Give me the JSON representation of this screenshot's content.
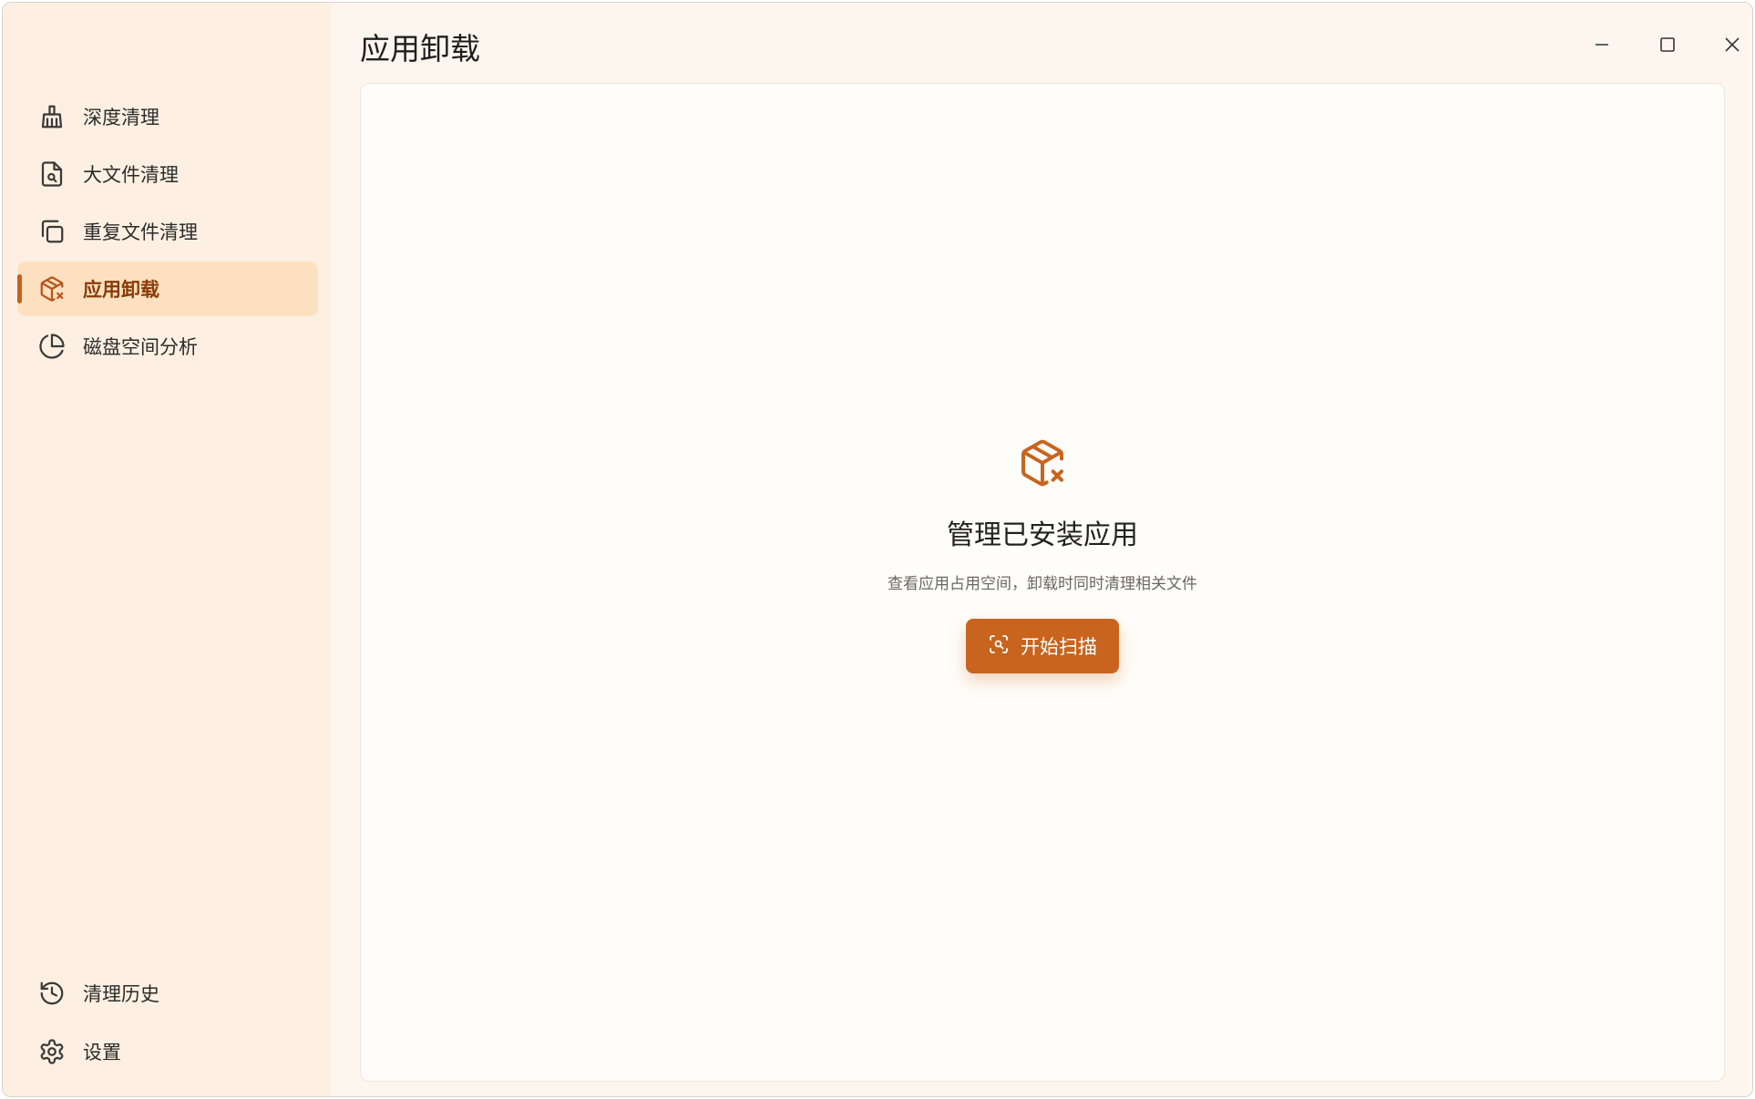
{
  "window": {
    "title": "应用卸载"
  },
  "sidebar": {
    "items": [
      {
        "label": "深度清理",
        "icon": "broom-icon",
        "active": false
      },
      {
        "label": "大文件清理",
        "icon": "file-search-icon",
        "active": false
      },
      {
        "label": "重复文件清理",
        "icon": "copy-icon",
        "active": false
      },
      {
        "label": "应用卸载",
        "icon": "package-x-icon",
        "active": true
      },
      {
        "label": "磁盘空间分析",
        "icon": "pie-chart-icon",
        "active": false
      }
    ],
    "bottom_items": [
      {
        "label": "清理历史",
        "icon": "history-icon"
      },
      {
        "label": "设置",
        "icon": "gear-icon"
      }
    ]
  },
  "window_controls": {
    "icons": [
      "minimize-icon",
      "maximize-icon",
      "close-icon"
    ]
  },
  "empty_state": {
    "icon": "package-x-icon",
    "title": "管理已安装应用",
    "description": "查看应用占用空间，卸载时同时清理相关文件",
    "button_label": "开始扫描",
    "button_icon": "scan-search-icon"
  },
  "colors": {
    "accent": "#c8641e",
    "sidebar_bg": "#fdf0e2",
    "active_item_bg": "#fde0c0",
    "active_text": "#8a3a08",
    "content_bg": "#fffdf9"
  }
}
